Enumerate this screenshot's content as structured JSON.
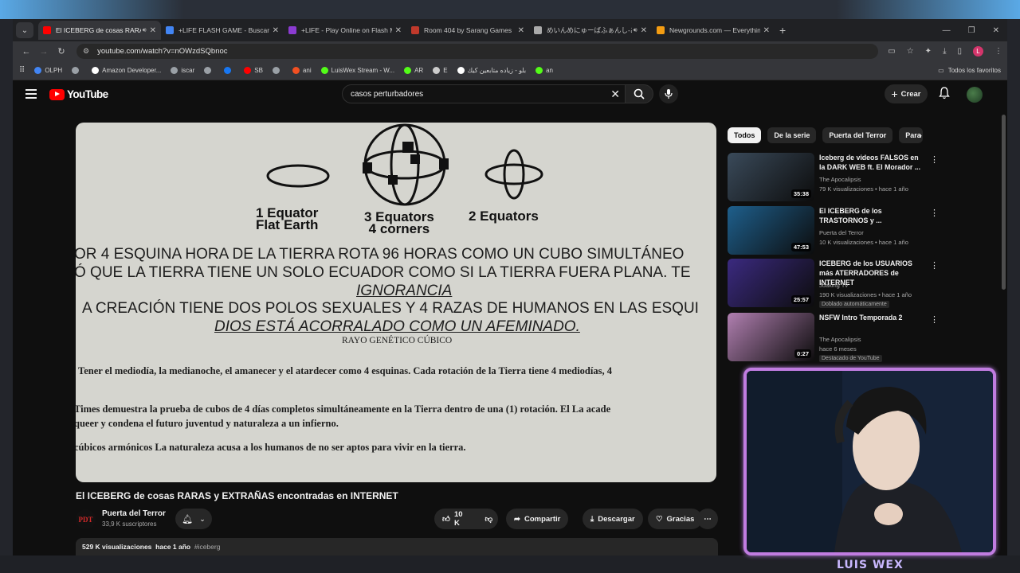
{
  "tabs": [
    {
      "title": "El ICEBERG de cosas RARAS",
      "color": "#ff0000",
      "active": true,
      "audio": true
    },
    {
      "title": "+LIFE FLASH GAME - Buscar con",
      "color": "#4285f4",
      "active": false,
      "audio": false
    },
    {
      "title": "+LIFE - Play Online on Flash M",
      "color": "#8b3bd1",
      "active": false,
      "audio": false
    },
    {
      "title": "Room 404 by Sarang Games",
      "color": "#c0392b",
      "active": false,
      "audio": false
    },
    {
      "title": "めいんめにゅーばふぁんし-あいん",
      "color": "#aaaaaa",
      "active": false,
      "audio": true
    },
    {
      "title": "Newgrounds.com — Everything",
      "color": "#f39c12",
      "active": false,
      "audio": false
    }
  ],
  "url": "youtube.com/watch?v=nOWzdSQbnoc",
  "bookmarks": [
    {
      "label": "OLPH",
      "color": "#4285f4"
    },
    {
      "label": "",
      "color": "#9aa0a6"
    },
    {
      "label": "Amazon Developer...",
      "color": "#ffffff"
    },
    {
      "label": "iscar",
      "color": "#9aa0a6"
    },
    {
      "label": "",
      "color": "#9aa0a6"
    },
    {
      "label": "",
      "color": "#1877f2"
    },
    {
      "label": "SB",
      "color": "#ff0000"
    },
    {
      "label": "",
      "color": "#9aa0a6"
    },
    {
      "label": "ani",
      "color": "#f25022"
    },
    {
      "label": "LuisWex Stream - W...",
      "color": "#53fc18"
    },
    {
      "label": "AR",
      "color": "#53fc18"
    },
    {
      "label": "E",
      "color": "#cccccc"
    },
    {
      "label": "بلو - زياده متابعين كيك",
      "color": "#ffffff"
    },
    {
      "label": "an",
      "color": "#53fc18"
    }
  ],
  "bookmarks_all": "Todos los favoritos",
  "youtube": {
    "logo": "YouTube",
    "search_query": "casos perturbadores",
    "create_label": "Crear"
  },
  "video_frame": {
    "eq1": [
      "1 Equator",
      "Flat Earth"
    ],
    "eq3": [
      "3 Equators",
      "4 corners"
    ],
    "eq2": [
      "2 Equators"
    ],
    "lines": [
      "OR 4 ESQUINA HORA DE LA TIERRA ROTA 96 HORAS COMO UN CUBO SIMULTÁNEO",
      "Ó QUE LA TIERRA TIENE UN SOLO ECUADOR COMO SI LA TIERRA FUERA PLANA. TE",
      "IGNORANCIA",
      "A CREACIÓN TIENE DOS POLOS SEXUALES Y 4 RAZAS DE HUMANOS EN LAS ESQUI",
      "DIOS ESTÁ ACORRALADO COMO UN AFEMINADO.",
      "RAYO GENÉTICO CÚBICO",
      "Tener el mediodía, la medianoche, el amanecer y el atardecer como 4 esquinas. Cada rotación de la Tierra tiene 4 mediodías, 4",
      "Times demuestra la prueba de cubos de 4 días completos simultáneamente en la Tierra dentro de una (1) rotación. El La acade",
      "queer y condena el futuro juventud y naturaleza a un infierno.",
      "cúbicos armónicos La naturaleza acusa a los humanos de no ser aptos para vivir en la tierra."
    ]
  },
  "video": {
    "title": "El ICEBERG de cosas RARAS y EXTRAÑAS encontradas en INTERNET",
    "channel": "Puerta del Terror",
    "channel_avatar": "PDT",
    "subscribers": "33,9 K suscriptores",
    "likes": "10 K",
    "share": "Compartir",
    "download": "Descargar",
    "thanks": "Gracias",
    "views": "529 K visualizaciones",
    "age": "hace 1 año",
    "hashtag": "#iceberg"
  },
  "chips": [
    "Todos",
    "De la serie",
    "Puerta del Terror",
    "Para"
  ],
  "recommendations": [
    {
      "title": "Iceberg de videos FALSOS en la DARK WEB ft. El Morador ...",
      "channel": "The Apocalipsis",
      "meta": "79 K visualizaciones • hace 1 año",
      "duration": "35:38",
      "badge": "",
      "thumb": "#3a4a5a"
    },
    {
      "title": "El ICEBERG de los TRASTORNOS y ...",
      "channel": "Puerta del Terror",
      "meta": "10 K visualizaciones • hace 1 año",
      "duration": "47:53",
      "badge": "",
      "thumb": "#1e5f8c"
    },
    {
      "title": "ICEBERG de los USUARIOS más ATERRADORES de INTERNET",
      "channel": "Joaking Tv",
      "meta": "190 K visualizaciones • hace 1 año",
      "duration": "25:57",
      "badge": "Doblado automáticamente",
      "thumb": "#3b2a80"
    },
    {
      "title": "NSFW Intro Temporada 2",
      "channel": "The Apocalipsis",
      "meta": "hace 6 meses",
      "duration": "0:27",
      "badge": "Destacado de YouTube",
      "thumb": "#b07fb0"
    }
  ],
  "streamer": "LUIS WEX"
}
